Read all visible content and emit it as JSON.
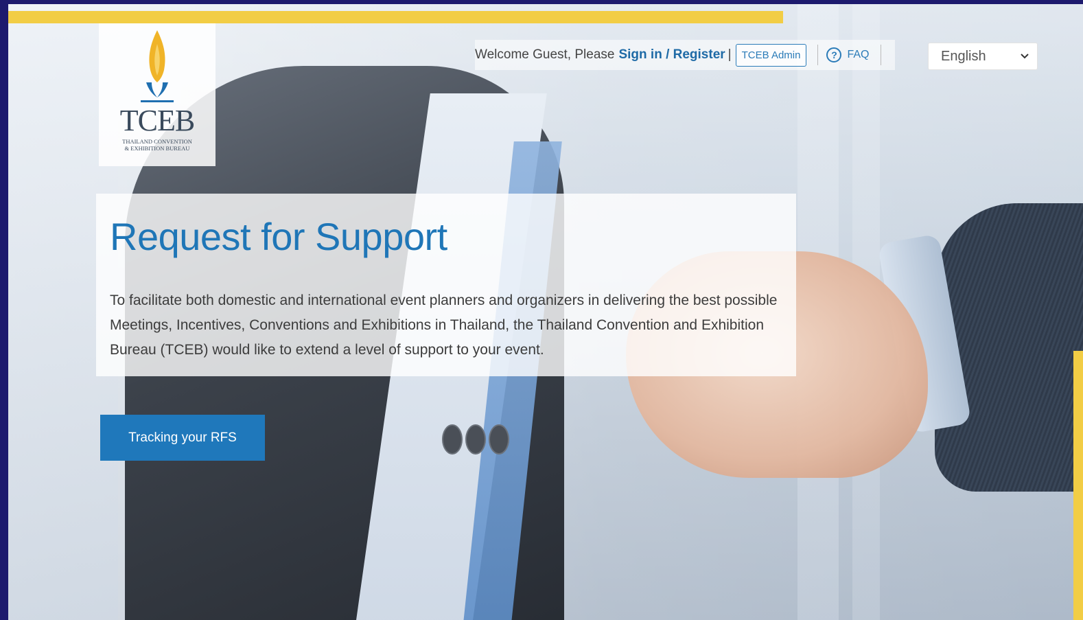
{
  "logo": {
    "wordmark": "TCEB",
    "subtitle_line1": "THAILAND CONVENTION",
    "subtitle_line2": "& EXHIBITION BUREAU"
  },
  "header": {
    "welcome_text": "Welcome Guest, Please",
    "signin_label": "Sign in / Register",
    "separator": "|",
    "admin_label": "TCEB Admin",
    "faq_label": "FAQ",
    "faq_icon": "question-circle-icon",
    "language": {
      "selected": "English"
    }
  },
  "hero": {
    "title": "Request for Support",
    "description": "To facilitate both domestic and international event planners and organizers in delivering the best possible Meetings, Incentives, Conventions and Exhibitions in Thailand, the Thailand Convention and Exhibition Bureau (TCEB) would like to extend a level of support to your event."
  },
  "actions": {
    "tracking_label": "Tracking your RFS"
  },
  "colors": {
    "accent_blue": "#1f76b7",
    "accent_yellow": "#f2cd45",
    "frame_border": "#1d1a6e"
  }
}
